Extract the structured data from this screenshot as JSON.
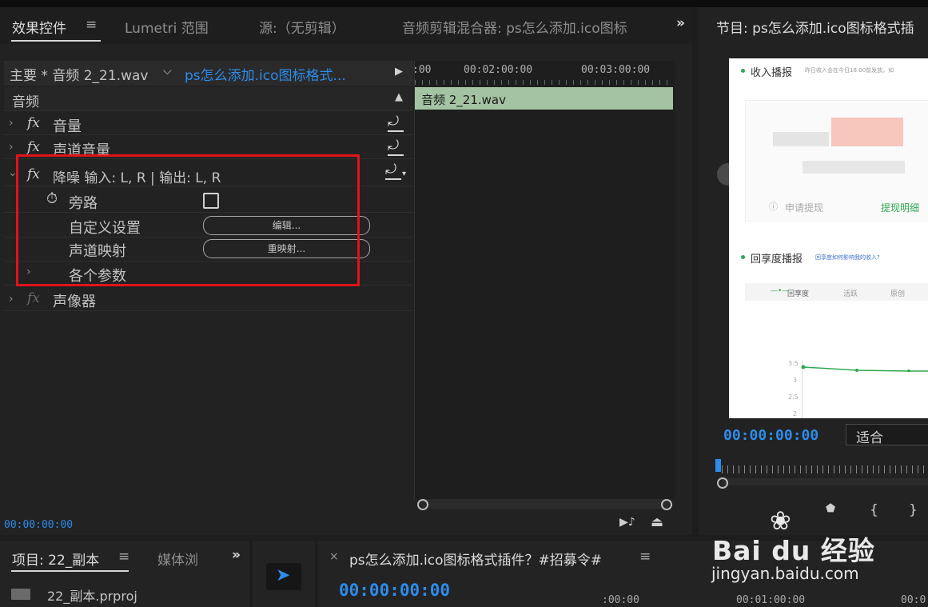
{
  "effect_controls_panel": {
    "tabs": [
      {
        "label": "效果控件"
      },
      {
        "label": "Lumetri 范围"
      },
      {
        "label": "源:（无剪辑）"
      },
      {
        "label": "音频剪辑混合器: ps怎么添加.ico图标"
      }
    ],
    "menu_glyph": "≡",
    "overflow_glyph": "»",
    "clip_source": "主要 * 音频 2_21.wav",
    "clip_sequence": "ps怎么添加.ico图标格式...",
    "section_header": "音频",
    "effects": [
      {
        "name": "音量"
      },
      {
        "name": "声道音量"
      },
      {
        "name": "降噪 输入: L, R | 输出: L, R"
      },
      {
        "name": "声像器"
      }
    ],
    "noise_reduction_params": {
      "bypass_label": "旁路",
      "custom_setup_label": "自定义设置",
      "custom_setup_button": "编辑...",
      "channel_map_label": "声道映射",
      "channel_map_button": "重映射...",
      "individual_params_label": "各个参数"
    },
    "timeline": {
      "ruler_labels": [
        ":00",
        "00:02:00:00",
        "00:03:00:00"
      ],
      "clip_label": "音频 2_21.wav"
    },
    "timecode": "00:00:00:00"
  },
  "program_monitor": {
    "title": "节目: ps怎么添加.ico图标格式插",
    "timecode": "00:00:00:00",
    "fit_option": "适合",
    "preview": {
      "section1_title": "收入播报",
      "section1_note": "昨日收入会在今日18:00前发放，如",
      "withdraw_label": "申请提现",
      "withdraw_detail_label": "提现明细",
      "section2_title": "回享度播报",
      "section2_link": "回享度如何影响我的收入?",
      "legend": [
        "回享度",
        "活跃",
        "原创"
      ],
      "y_ticks": [
        "3.5",
        "3",
        "2.5",
        "2"
      ]
    }
  },
  "project_panel": {
    "tabs": [
      {
        "label": "项目: 22_副本"
      },
      {
        "label": "媒体浏"
      }
    ],
    "menu_glyph": "≡",
    "overflow_glyph": "»",
    "item_label": "22_副本.prproj"
  },
  "sequence_panel": {
    "close_glyph": "×",
    "title": "ps怎么添加.ico图标格式插件？#招募令#",
    "menu_glyph": "≡",
    "timecode": "00:00:00:00",
    "ruler_labels": [
      ":00:00",
      "00:01:00:00",
      "00:0"
    ]
  },
  "watermark": {
    "brand": "Bai du 经验",
    "url": "jingyan.baidu.com"
  },
  "colors": {
    "highlight_box": "#e1131a",
    "timecode_blue": "#2d8ceb",
    "clip_green": "#a4c3a2"
  }
}
